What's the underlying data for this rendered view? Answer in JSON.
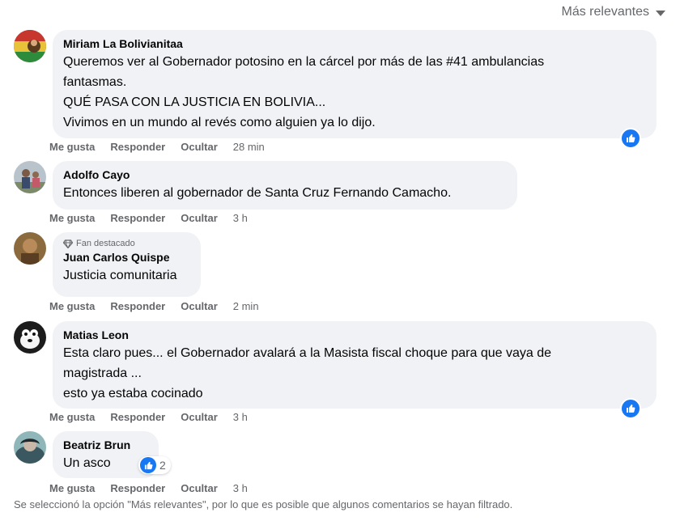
{
  "sort": {
    "label": "Más relevantes"
  },
  "comments": [
    {
      "author": "Miriam La Bolivianitaa",
      "lines": [
        "Queremos ver al Gobernador potosino en la cárcel por más de las #41 ambulancias",
        "fantasmas.",
        "QUÉ PASA CON LA JUSTICIA EN BOLIVIA...",
        "Vivimos en un mundo al revés como alguien ya lo dijo."
      ],
      "time": "28 min"
    },
    {
      "author": "Adolfo Cayo",
      "lines": [
        "Entonces liberen al gobernador de Santa Cruz Fernando Camacho."
      ],
      "time": "3 h"
    },
    {
      "badge": "Fan destacado",
      "author": "Juan Carlos Quispe",
      "lines": [
        "Justicia comunitaria"
      ],
      "time": "2 min"
    },
    {
      "author": "Matias Leon",
      "lines": [
        "Esta claro pues... el Gobernador avalará a la Masista fiscal choque para que vaya de",
        "magistrada ...",
        "esto ya estaba cocinado"
      ],
      "time": "3 h"
    },
    {
      "author": "Beatriz Brun",
      "lines": [
        "Un asco"
      ],
      "reaction_count": "2",
      "time": "3 h"
    }
  ],
  "actions": {
    "like": "Me gusta",
    "reply": "Responder",
    "hide": "Ocultar"
  },
  "footer": "Se seleccionó la opción \"Más relevantes\", por lo que es posible que algunos comentarios se hayan filtrado.",
  "colors": {
    "like_blue": "#1877f2",
    "bubble": "#f0f2f5",
    "muted": "#65676b"
  },
  "icons": [
    "caret-down-icon",
    "like-icon",
    "diamond-icon"
  ]
}
